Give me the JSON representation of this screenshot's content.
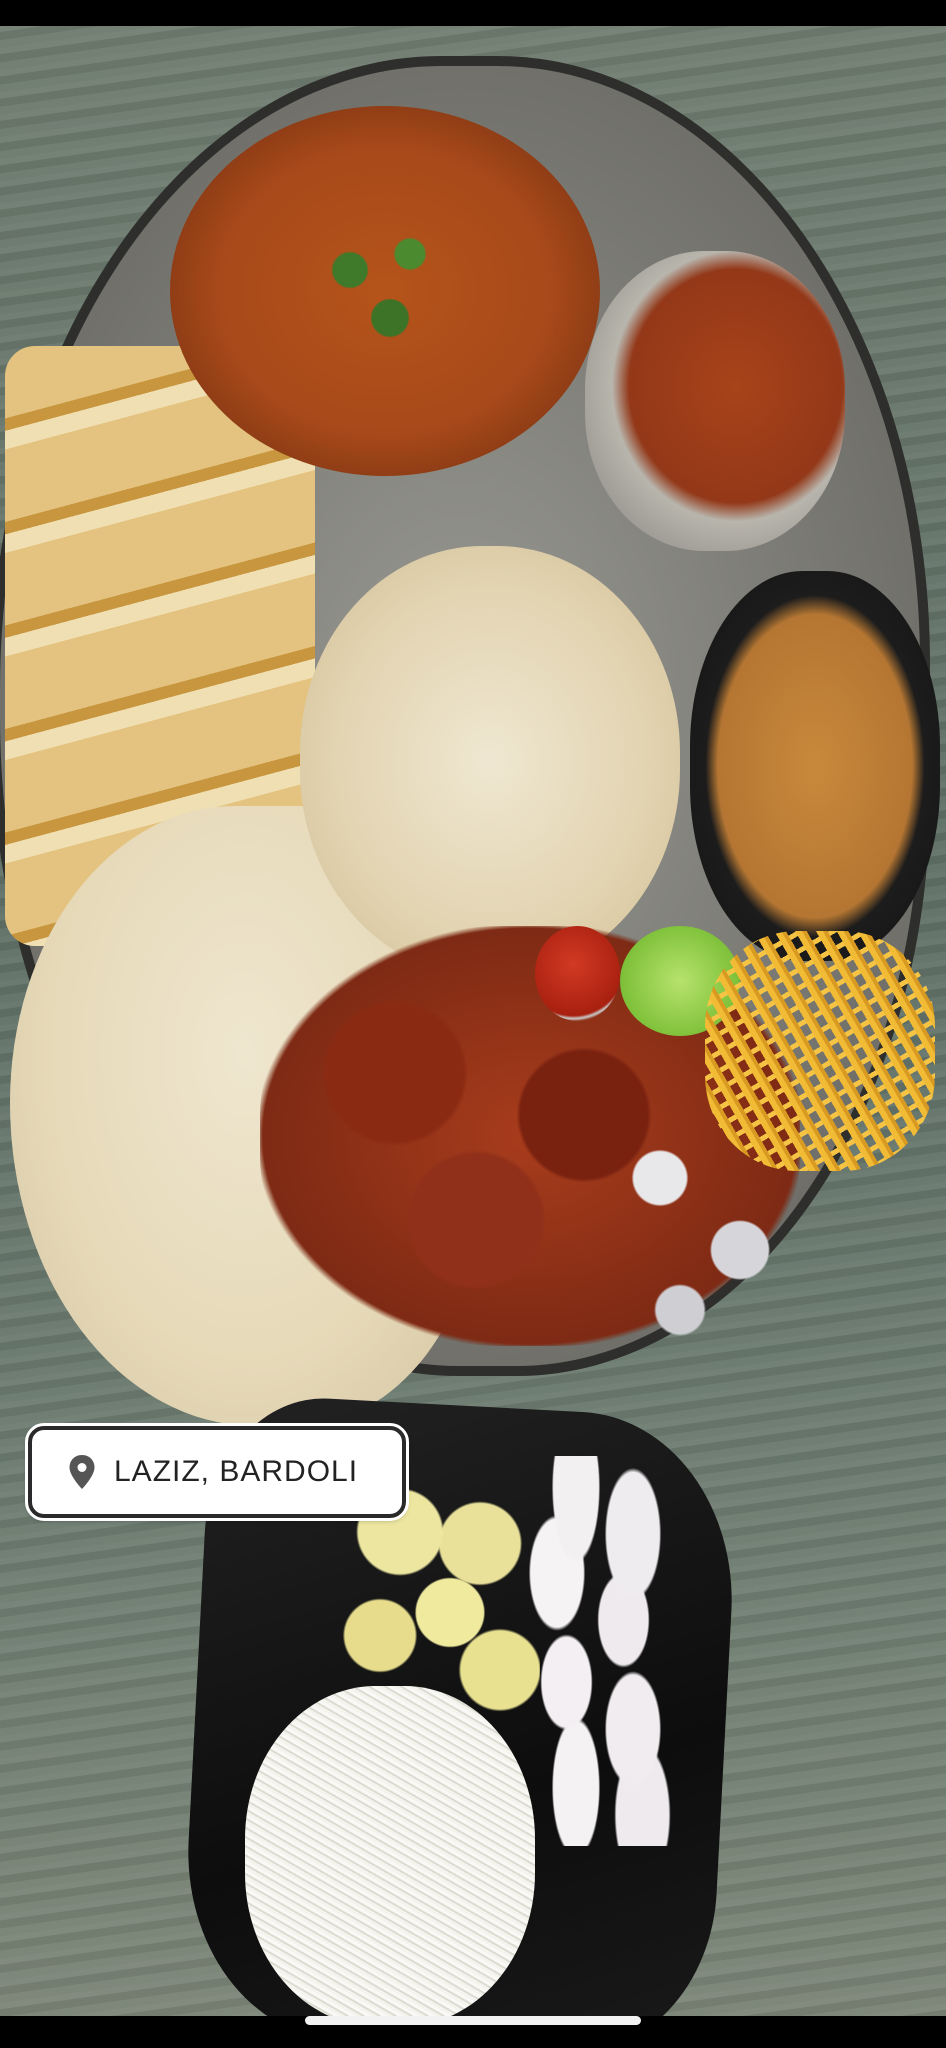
{
  "location_tag": {
    "icon": "location-pin-icon",
    "label": "LAZIZ, BARDOLI"
  },
  "colors": {
    "tag_background": "#ffffff",
    "tag_text": "#222222",
    "home_indicator": "#f2f2f2"
  }
}
